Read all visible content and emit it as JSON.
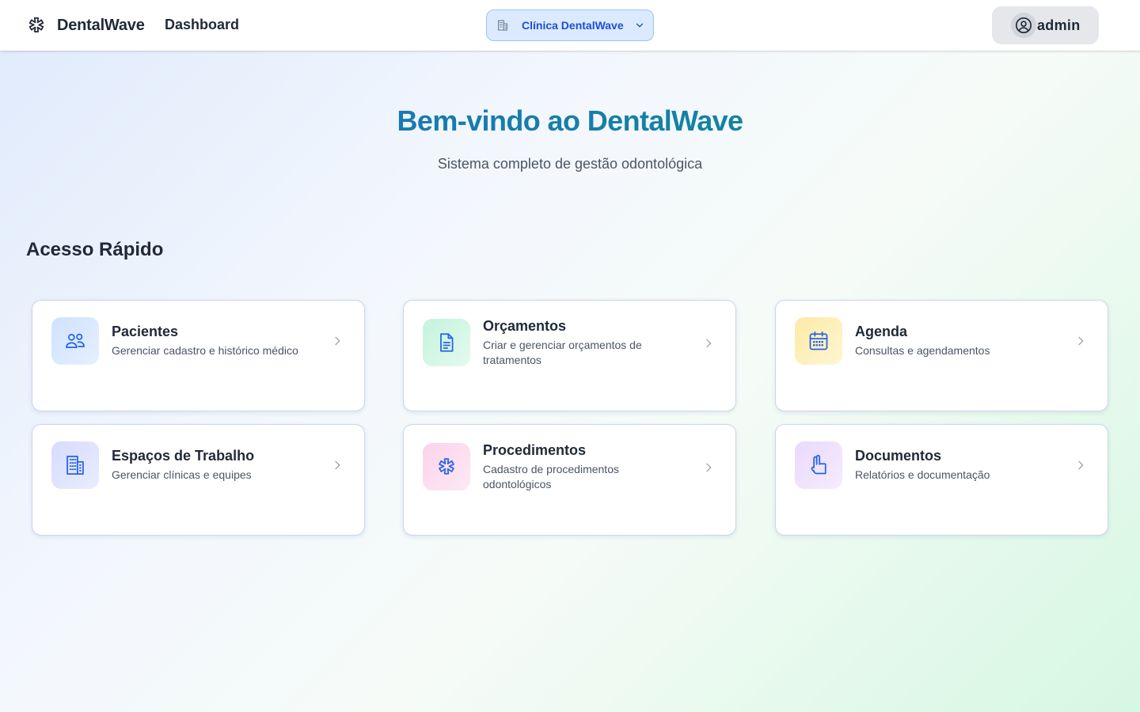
{
  "header": {
    "brand": "DentalWave",
    "nav_dashboard": "Dashboard",
    "clinic_selected": "Clínica DentalWave",
    "user_name": "admin"
  },
  "hero": {
    "title": "Bem-vindo ao DentalWave",
    "subtitle": "Sistema completo de gestão odontológica"
  },
  "quick_access": {
    "title": "Acesso Rápido",
    "cards": [
      {
        "title": "Pacientes",
        "description": "Gerenciar cadastro e histórico médico",
        "icon": "users-icon",
        "accent": "#dbeafe"
      },
      {
        "title": "Orçamentos",
        "description": "Criar e gerenciar orçamentos de tratamentos",
        "icon": "document-icon",
        "accent": "#d1fae5"
      },
      {
        "title": "Agenda",
        "description": "Consultas e agendamentos",
        "icon": "calendar-icon",
        "accent": "#fef3c7"
      },
      {
        "title": "Espaços de Trabalho",
        "description": "Gerenciar clínicas e equipes",
        "icon": "building-icon",
        "accent": "#e0e7ff"
      },
      {
        "title": "Procedimentos",
        "description": "Cadastro de procedimentos odontológicos",
        "icon": "asterisk-icon",
        "accent": "#fce7f3"
      },
      {
        "title": "Documentos",
        "description": "Relatórios e documentação",
        "icon": "hand-paper-icon",
        "accent": "#f3e8ff"
      }
    ]
  },
  "colors": {
    "accent_blue": "#1d4ed8",
    "title_gradient_start": "#1d6fc4",
    "title_gradient_end": "#0e8a8a"
  }
}
